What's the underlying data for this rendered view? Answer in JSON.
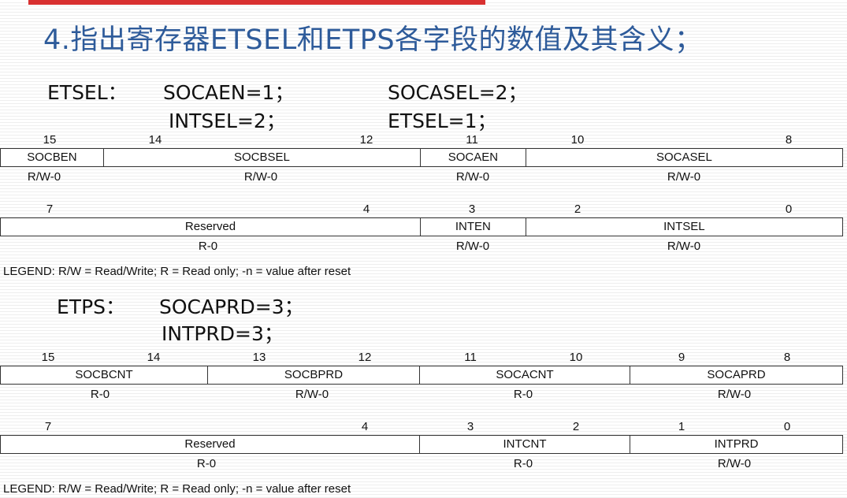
{
  "title": "4.指出寄存器ETSEL和ETPS各字段的数值及其含义；",
  "etsel": {
    "label": "ETSEL：",
    "values": [
      "SOCAEN=1；",
      "SOCASEL=2；",
      "INTSEL=2；",
      "ETSEL=1；"
    ],
    "high": {
      "bits": [
        "15",
        "14",
        "12",
        "11",
        "10",
        "8"
      ],
      "fields": [
        "SOCBEN",
        "SOCBSEL",
        "SOCAEN",
        "SOCASEL"
      ],
      "access": [
        "R/W-0",
        "R/W-0",
        "R/W-0",
        "R/W-0"
      ]
    },
    "low": {
      "bits": [
        "7",
        "4",
        "3",
        "2",
        "0"
      ],
      "fields": [
        "Reserved",
        "INTEN",
        "INTSEL"
      ],
      "access": [
        "R-0",
        "R/W-0",
        "R/W-0"
      ]
    },
    "legend": "LEGEND: R/W = Read/Write; R = Read only; -n = value after reset"
  },
  "etps": {
    "label": "ETPS：",
    "values": [
      "SOCAPRD=3；",
      "INTPRD=3；"
    ],
    "high": {
      "bits": [
        "15",
        "14",
        "13",
        "12",
        "11",
        "10",
        "9",
        "8"
      ],
      "fields": [
        "SOCBCNT",
        "SOCBPRD",
        "SOCACNT",
        "SOCAPRD"
      ],
      "access": [
        "R-0",
        "R/W-0",
        "R-0",
        "R/W-0"
      ]
    },
    "low": {
      "bits": [
        "7",
        "4",
        "3",
        "2",
        "1",
        "0"
      ],
      "fields": [
        "Reserved",
        "INTCNT",
        "INTPRD"
      ],
      "access": [
        "R-0",
        "R-0",
        "R/W-0"
      ]
    },
    "legend": "LEGEND: R/W = Read/Write; R = Read only; -n = value after reset"
  }
}
